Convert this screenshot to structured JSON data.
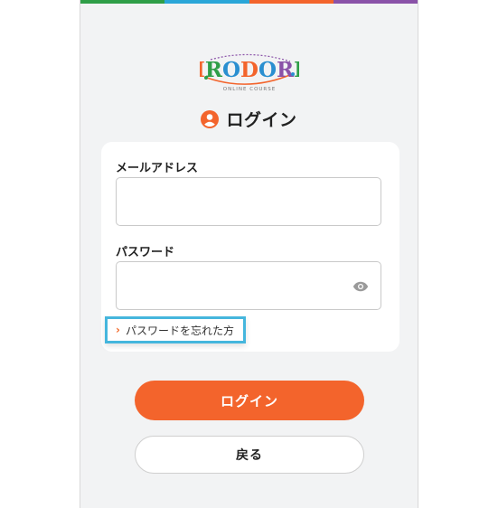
{
  "brand": {
    "logo_letters": [
      "I",
      "R",
      "O",
      "D",
      "O",
      "R",
      "I"
    ],
    "logo_letter_colors": [
      "#f3642c",
      "#2f9e47",
      "#2a8fd0",
      "#f3642c",
      "#2a8fd0",
      "#8a52a8",
      "#2f9e47"
    ],
    "logo_tagline": "ONLINE COURSE",
    "stripe_colors": [
      "#2f9e47",
      "#2aa6d8",
      "#f3642c",
      "#8a52a8"
    ]
  },
  "heading": {
    "icon": "user-circle-icon",
    "title": "ログイン"
  },
  "form": {
    "email_label": "メールアドレス",
    "email_value": "",
    "password_label": "パスワード",
    "password_value": "",
    "password_toggle_icon": "eye-icon",
    "forgot_password": "パスワードを忘れた方",
    "forgot_chevron": "›"
  },
  "actions": {
    "login_label": "ログイン",
    "back_label": "戻る"
  },
  "colors": {
    "accent": "#f3642c",
    "highlight": "#45b6dd"
  }
}
